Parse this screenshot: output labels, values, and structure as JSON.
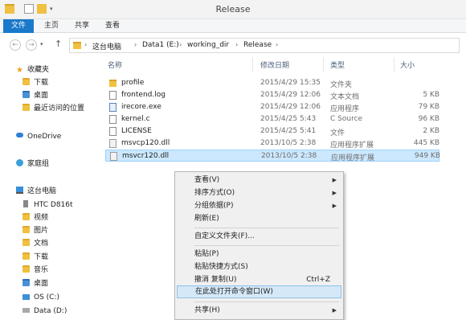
{
  "window": {
    "title": "Release"
  },
  "ribbon": {
    "tabs": [
      "文件",
      "主页",
      "共享",
      "查看"
    ]
  },
  "address": {
    "crumbs": [
      "这台电脑",
      "Data1 (E:)",
      "working_dir",
      "Release"
    ],
    "back_icon": "back-arrow-icon",
    "forward_icon": "forward-arrow-icon",
    "up_icon": "up-arrow-icon"
  },
  "nav": {
    "favorites": "收藏夹",
    "favorite_items": [
      "下载",
      "桌面",
      "最近访问的位置"
    ],
    "onedrive": "OneDrive",
    "homegroup": "家庭组",
    "thispc": "这台电脑",
    "pc_items": [
      "HTC D816t",
      "视频",
      "图片",
      "文档",
      "下载",
      "音乐",
      "桌面",
      "OS (C:)",
      "Data (D:)"
    ]
  },
  "columns": {
    "name": "名称",
    "date": "修改日期",
    "type": "类型",
    "size": "大小"
  },
  "files": [
    {
      "name": "profile",
      "date": "2015/4/29 15:35",
      "type": "文件夹",
      "size": ""
    },
    {
      "name": "frontend.log",
      "date": "2015/4/29 12:06",
      "type": "文本文档",
      "size": "5 KB"
    },
    {
      "name": "irecore.exe",
      "date": "2015/4/29 12:06",
      "type": "应用程序",
      "size": "79 KB"
    },
    {
      "name": "kernel.c",
      "date": "2015/4/25 5:43",
      "type": "C Source",
      "size": "96 KB"
    },
    {
      "name": "LICENSE",
      "date": "2015/4/25 5:41",
      "type": "文件",
      "size": "2 KB"
    },
    {
      "name": "msvcp120.dll",
      "date": "2013/10/5 2:38",
      "type": "应用程序扩展",
      "size": "445 KB"
    },
    {
      "name": "msvcr120.dll",
      "date": "2013/10/5 2:38",
      "type": "应用程序扩展",
      "size": "949 KB"
    }
  ],
  "context_menu": {
    "view": "查看(V)",
    "sort": "排序方式(O)",
    "group": "分组依据(P)",
    "refresh": "刷新(E)",
    "customize": "自定义文件夹(F)...",
    "paste": "粘贴(P)",
    "paste_shortcut": "粘贴快捷方式(S)",
    "undo": "撤消 复制(U)",
    "undo_shortcut": "Ctrl+Z",
    "open_cmd": "在此处打开命令窗口(W)",
    "share": "共享(H)"
  },
  "colors": {
    "accent": "#1979ca",
    "selection": "#cce8ff",
    "menu_hover": "#d5e8f8"
  }
}
